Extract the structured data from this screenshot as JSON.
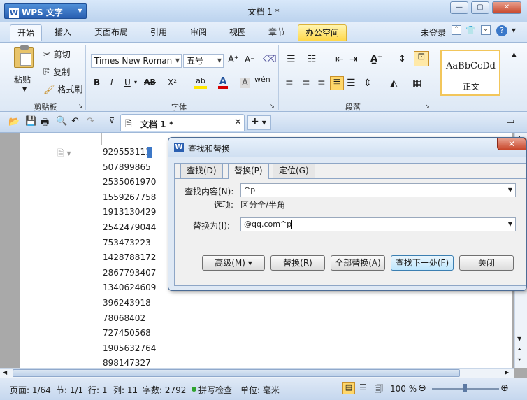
{
  "app": {
    "logo_text": "WPS 文字",
    "logo_mark": "W",
    "window_title": "文档 1 *"
  },
  "window_controls": {
    "minimize": "—",
    "maximize": "▢",
    "close": "✕"
  },
  "tabs": [
    "开始",
    "插入",
    "页面布局",
    "引用",
    "审阅",
    "视图",
    "章节",
    "办公空间"
  ],
  "account": {
    "label": "未登录"
  },
  "ribbon": {
    "clipboard": {
      "paste": "粘贴",
      "cut": "剪切",
      "copy": "复制",
      "format_painter": "格式刷",
      "group_label": "剪贴板"
    },
    "font": {
      "font_name": "Times New Roman",
      "font_size": "五号",
      "group_label": "字体",
      "bold": "B",
      "italic": "I",
      "underline": "U",
      "strike": "AB",
      "super": "X²",
      "grow": "A⁺",
      "shrink": "A⁻",
      "color_a": "A",
      "phonetic": "wén"
    },
    "paragraph": {
      "group_label": "段落"
    },
    "styles": {
      "preview": "AaBbCcDd",
      "name": "正文"
    }
  },
  "doc_tab": {
    "title": "文档 1 *",
    "close": "×",
    "add": "+"
  },
  "numbers": [
    "929553111",
    "507899865",
    "2535061970",
    "1559267758",
    "1913130429",
    "2542479044",
    "753473223",
    "1428788172",
    "2867793407",
    "1340624609",
    "396243918",
    "78068402",
    "727450568",
    "1905632764",
    "898147327"
  ],
  "status": {
    "page": "页面: 1/64",
    "section": "节: 1/1",
    "row": "行: 1",
    "col": "列: 11",
    "chars": "字数: 2792",
    "spell": "拼写检查",
    "unit": "单位: 毫米",
    "zoom": "100 %"
  },
  "dialog": {
    "title": "查找和替换",
    "tabs": [
      "查找(D)",
      "替换(P)",
      "定位(G)"
    ],
    "find_label": "查找内容(N):",
    "find_value": "^p",
    "options_label": "选项:",
    "options_value": "区分全/半角",
    "replace_label": "替换为(I):",
    "replace_value": "@qq.com^p",
    "buttons": {
      "advanced": "高级(M) ▾",
      "replace": "替换(R)",
      "replace_all": "全部替换(A)",
      "find_next": "查找下一处(F)",
      "close": "关闭"
    }
  }
}
